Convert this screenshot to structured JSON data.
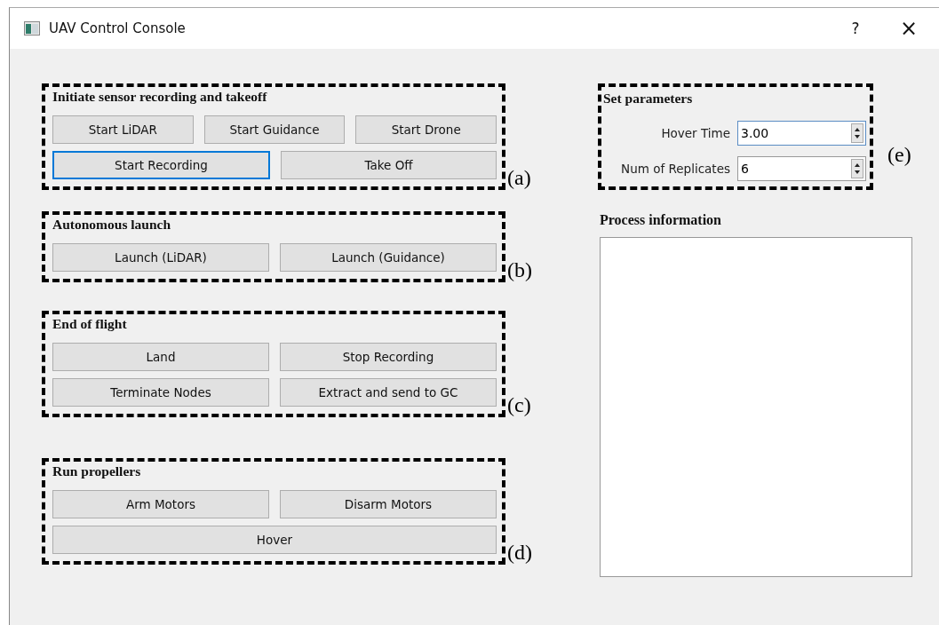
{
  "window": {
    "title": "UAV Control Console",
    "help": "?",
    "close": "×"
  },
  "groups": [
    {
      "title": "Initiate sensor recording and takeoff",
      "tag": "(a)",
      "rows": [
        [
          {
            "label": "Start LiDAR",
            "focused": false
          },
          {
            "label": "Start Guidance",
            "focused": false
          },
          {
            "label": "Start Drone",
            "focused": false
          }
        ],
        [
          {
            "label": "Start Recording",
            "focused": true
          },
          {
            "label": "Take Off",
            "focused": false
          }
        ]
      ]
    },
    {
      "title": "Autonomous launch",
      "tag": "(b)",
      "rows": [
        [
          {
            "label": "Launch (LiDAR)",
            "focused": false
          },
          {
            "label": "Launch (Guidance)",
            "focused": false
          }
        ]
      ]
    },
    {
      "title": "End of flight",
      "tag": "(c)",
      "rows": [
        [
          {
            "label": "Land",
            "focused": false
          },
          {
            "label": "Stop Recording",
            "focused": false
          }
        ],
        [
          {
            "label": "Terminate Nodes",
            "focused": false
          },
          {
            "label": "Extract and send to GC",
            "focused": false
          }
        ]
      ]
    },
    {
      "title": "Run propellers",
      "tag": "(d)",
      "rows": [
        [
          {
            "label": "Arm Motors",
            "focused": false
          },
          {
            "label": "Disarm Motors",
            "focused": false
          }
        ],
        [
          {
            "label": "Hover",
            "focused": false
          }
        ]
      ]
    }
  ],
  "parameters": {
    "title": "Set parameters",
    "tag": "(e)",
    "fields": [
      {
        "label": "Hover Time",
        "value": "3.00",
        "focused": true
      },
      {
        "label": "Num of Replicates",
        "value": "6",
        "focused": false
      }
    ]
  },
  "process_information": {
    "title": "Process information"
  }
}
